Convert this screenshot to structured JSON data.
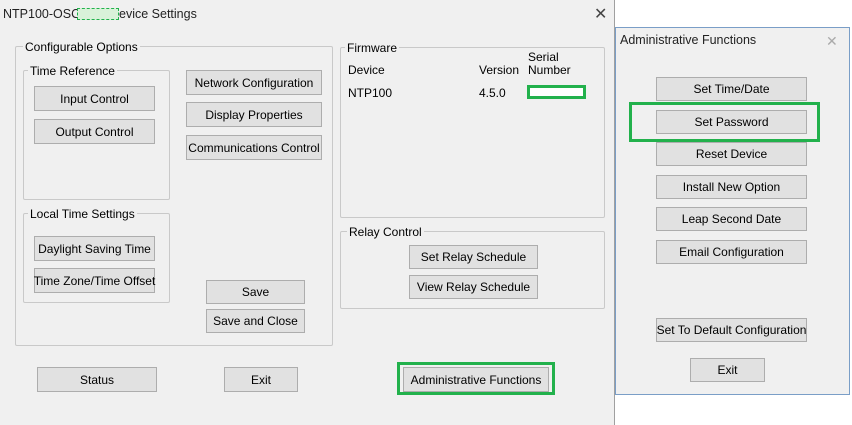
{
  "main_window": {
    "title_left": "NTP100-OSC-",
    "title_right": "evice Settings",
    "close_glyph": "✕"
  },
  "configurable_options": {
    "label": "Configurable Options",
    "time_reference": {
      "label": "Time Reference",
      "input_control": "Input Control",
      "output_control": "Output Control"
    },
    "network_configuration": "Network Configuration",
    "display_properties": "Display Properties",
    "communications_control": "Communications Control",
    "local_time_settings": {
      "label": "Local Time Settings",
      "daylight_saving_time": "Daylight Saving Time",
      "time_zone_offset": "Time Zone/Time Offset"
    },
    "save": "Save",
    "save_and_close": "Save and Close"
  },
  "firmware": {
    "label": "Firmware",
    "col_device": "Device",
    "col_version": "Version",
    "col_serial_line1": "Serial",
    "col_serial_line2": "Number",
    "row": {
      "device": "NTP100",
      "version": "4.5.0"
    }
  },
  "relay_control": {
    "label": "Relay Control",
    "set_relay_schedule": "Set Relay Schedule",
    "view_relay_schedule": "View Relay Schedule"
  },
  "bottom": {
    "status": "Status",
    "exit": "Exit",
    "administrative_functions": "Administrative Functions"
  },
  "admin_dialog": {
    "title": "Administrative Functions",
    "close_glyph": "✕",
    "set_time_date": "Set Time/Date",
    "set_password": "Set Password",
    "reset_device": "Reset Device",
    "install_new_option": "Install New Option",
    "leap_second_date": "Leap Second Date",
    "email_configuration": "Email Configuration",
    "set_to_default": "Set To Default Configuration",
    "exit": "Exit"
  },
  "colors": {
    "highlight": "#22b14c",
    "window_bg": "#f0f0f0",
    "button_bg": "#e1e1e1"
  }
}
